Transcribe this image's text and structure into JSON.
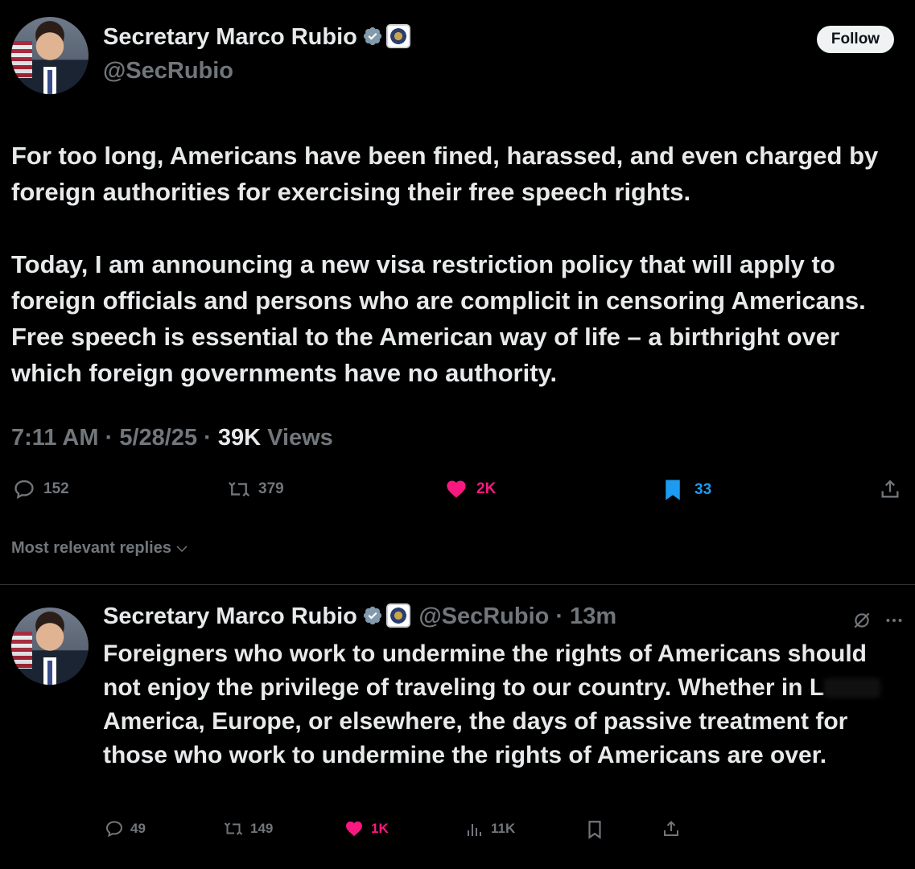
{
  "post": {
    "author_name": "Secretary Marco Rubio",
    "author_handle": "@SecRubio",
    "follow_label": "Follow",
    "paragraph1": "For too long, Americans have been fined, harassed, and even charged by foreign authorities for exercising their free speech rights.",
    "paragraph2": "Today, I am announcing a new visa restriction policy that will apply to foreign officials and persons who are complicit in censoring Americans. Free speech is essential to the American way of life – a birthright over which foreign governments have no authority.",
    "time": "7:11 AM",
    "date": "5/28/25",
    "views_count": "39K",
    "views_label": "Views",
    "replies": "152",
    "reposts": "379",
    "likes": "2K",
    "bookmarks": "33"
  },
  "replies_filter": "Most relevant replies",
  "reply": {
    "author_name": "Secretary Marco Rubio",
    "author_handle": "@SecRubio",
    "time_ago": "13m",
    "text_before": "Foreigners who work to undermine the rights of Americans should not enjoy the privilege of traveling to our country.  Whether in L",
    "text_after": " America, Europe, or elsewhere, the days of passive treatment for those who work to undermine the rights of Americans are over.",
    "replies": "49",
    "reposts": "149",
    "likes": "1K",
    "views": "11K"
  },
  "colors": {
    "background": "#000000",
    "text": "#e7e9ea",
    "muted": "#71767b",
    "like": "#f91880",
    "bookmark": "#1d9bf0",
    "verified": "#829aab"
  },
  "icons": [
    "verified-badge-icon",
    "state-department-seal-icon",
    "reply-icon",
    "repost-icon",
    "heart-icon",
    "bookmark-icon",
    "share-icon",
    "chevron-down-icon",
    "grok-icon",
    "more-icon",
    "views-icon"
  ]
}
